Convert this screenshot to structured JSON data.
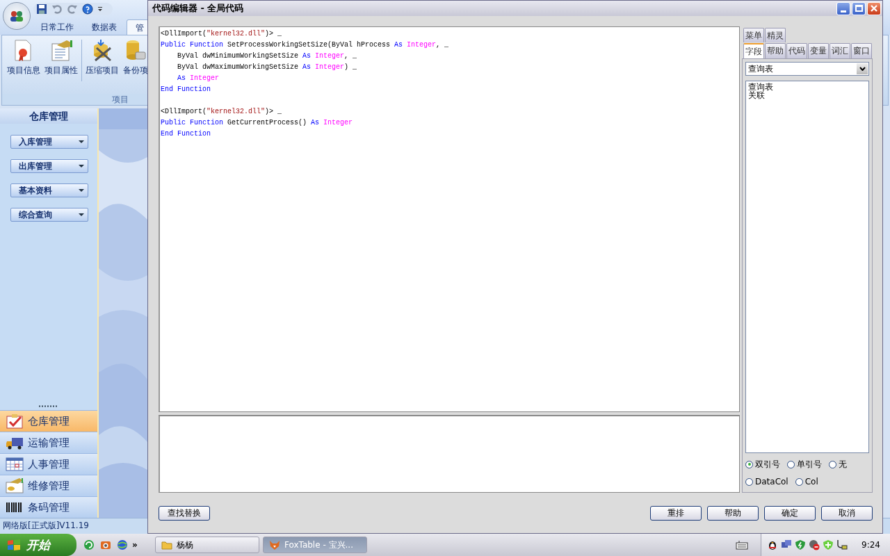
{
  "app": {
    "ribbon_tabs": [
      {
        "label": "日常工作",
        "selected": false
      },
      {
        "label": "数据表",
        "selected": false
      },
      {
        "label": "管",
        "selected": true
      }
    ],
    "ribbon_buttons": [
      "项目信息",
      "项目属性",
      "压缩项目",
      "备份项"
    ],
    "ribbon_group": "项目",
    "nav_title": "仓库管理",
    "nav_dropdowns": [
      "入库管理",
      "出库管理",
      "基本资料",
      "综合查询"
    ],
    "nav_items": [
      {
        "label": "仓库管理",
        "selected": true
      },
      {
        "label": "运输管理",
        "selected": false
      },
      {
        "label": "人事管理",
        "selected": false
      },
      {
        "label": "维修管理",
        "selected": false
      },
      {
        "label": "条码管理",
        "selected": false
      }
    ],
    "status": "网络版[正式版]V11.19"
  },
  "dialog": {
    "title": "代码编辑器 - 全局代码",
    "code_blocks": [
      [
        [
          {
            "kind": "plain",
            "text": "<DllImport("
          },
          {
            "kind": "string",
            "text": "\"kernel32.dll\""
          },
          {
            "kind": "plain",
            "text": ")> _"
          }
        ],
        [
          {
            "kind": "keyword",
            "text": "Public Function"
          },
          {
            "kind": "plain",
            "text": " SetProcessWorkingSetSize(ByVal hProcess "
          },
          {
            "kind": "keyword",
            "text": "As"
          },
          {
            "kind": "type",
            "text": " Integer"
          },
          {
            "kind": "plain",
            "text": ", _"
          }
        ],
        [
          {
            "kind": "plain",
            "text": "    ByVal dwMinimumWorkingSetSize "
          },
          {
            "kind": "keyword",
            "text": "As"
          },
          {
            "kind": "type",
            "text": " Integer"
          },
          {
            "kind": "plain",
            "text": ", _"
          }
        ],
        [
          {
            "kind": "plain",
            "text": "    ByVal dwMaximumWorkingSetSize "
          },
          {
            "kind": "keyword",
            "text": "As"
          },
          {
            "kind": "type",
            "text": " Integer"
          },
          {
            "kind": "plain",
            "text": ") _"
          }
        ],
        [
          {
            "kind": "keyword",
            "text": "    As"
          },
          {
            "kind": "type",
            "text": " Integer"
          }
        ],
        [
          {
            "kind": "keyword",
            "text": "End Function"
          }
        ]
      ],
      [
        [
          {
            "kind": "plain",
            "text": "<DllImport("
          },
          {
            "kind": "string",
            "text": "\"kernel32.dll\""
          },
          {
            "kind": "plain",
            "text": ")> _"
          }
        ],
        [
          {
            "kind": "keyword",
            "text": "Public Function"
          },
          {
            "kind": "plain",
            "text": " GetCurrentProcess() "
          },
          {
            "kind": "keyword",
            "text": "As"
          },
          {
            "kind": "type",
            "text": " Integer"
          }
        ],
        [
          {
            "kind": "keyword",
            "text": "End Function"
          }
        ]
      ]
    ],
    "panel_tabs_back": [
      {
        "label": "菜单",
        "selected": false
      },
      {
        "label": "精灵",
        "selected": false
      }
    ],
    "panel_tabs_front": [
      {
        "label": "字段",
        "selected": true
      },
      {
        "label": "帮助",
        "selected": false
      },
      {
        "label": "代码",
        "selected": false
      },
      {
        "label": "变量",
        "selected": false
      },
      {
        "label": "词汇",
        "selected": false
      },
      {
        "label": "窗口",
        "selected": false
      }
    ],
    "table_select": "查询表",
    "list_items": [
      "查询表",
      "关联"
    ],
    "radio_rows": [
      [
        {
          "label": "双引号",
          "selected": true
        },
        {
          "label": "单引号",
          "selected": false
        },
        {
          "label": "无",
          "selected": false
        }
      ],
      [
        {
          "label": "DataCol",
          "selected": false
        },
        {
          "label": "Col",
          "selected": false
        }
      ]
    ],
    "left_buttons": [
      "查找替换"
    ],
    "right_buttons": [
      "重排",
      "帮助",
      "确定",
      "取消"
    ]
  },
  "taskbar": {
    "start": "开始",
    "more": "»",
    "tasks": [
      {
        "label": "杨杨",
        "selected": false
      },
      {
        "label": "FoxTable - 宝兴...",
        "selected": true
      }
    ],
    "clock": "9:24"
  }
}
